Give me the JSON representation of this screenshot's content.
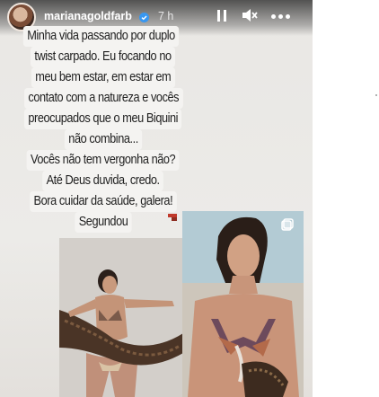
{
  "header": {
    "username": "marianagoldfarb",
    "time_ago": "7 h",
    "avatar_icon": "profile-avatar",
    "verified_icon": "verified-badge-icon",
    "controls": [
      "pause-icon",
      "mute-icon",
      "more-icon"
    ]
  },
  "caption": {
    "lines": [
      "Minha vida passando por duplo",
      "twist carpado. Eu focando no",
      "meu bem estar, em estar em",
      "contato com a natureza e vocês",
      "preocupados que o meu Biquini",
      "não combina...",
      "Vocês não tem vergonha não?",
      "Até Deus duvida, credo.",
      "Bora cuidar da saúde, galera!",
      "Segundou"
    ]
  },
  "photos": [
    {
      "name": "left-photo",
      "description_icon": "beach-photo"
    },
    {
      "name": "right-photo",
      "description_icon": "beach-photo"
    }
  ],
  "colors": {
    "caption_bg": "#f4f3f1",
    "caption_text": "#1f1f1f",
    "header_text": "#ffffff"
  }
}
